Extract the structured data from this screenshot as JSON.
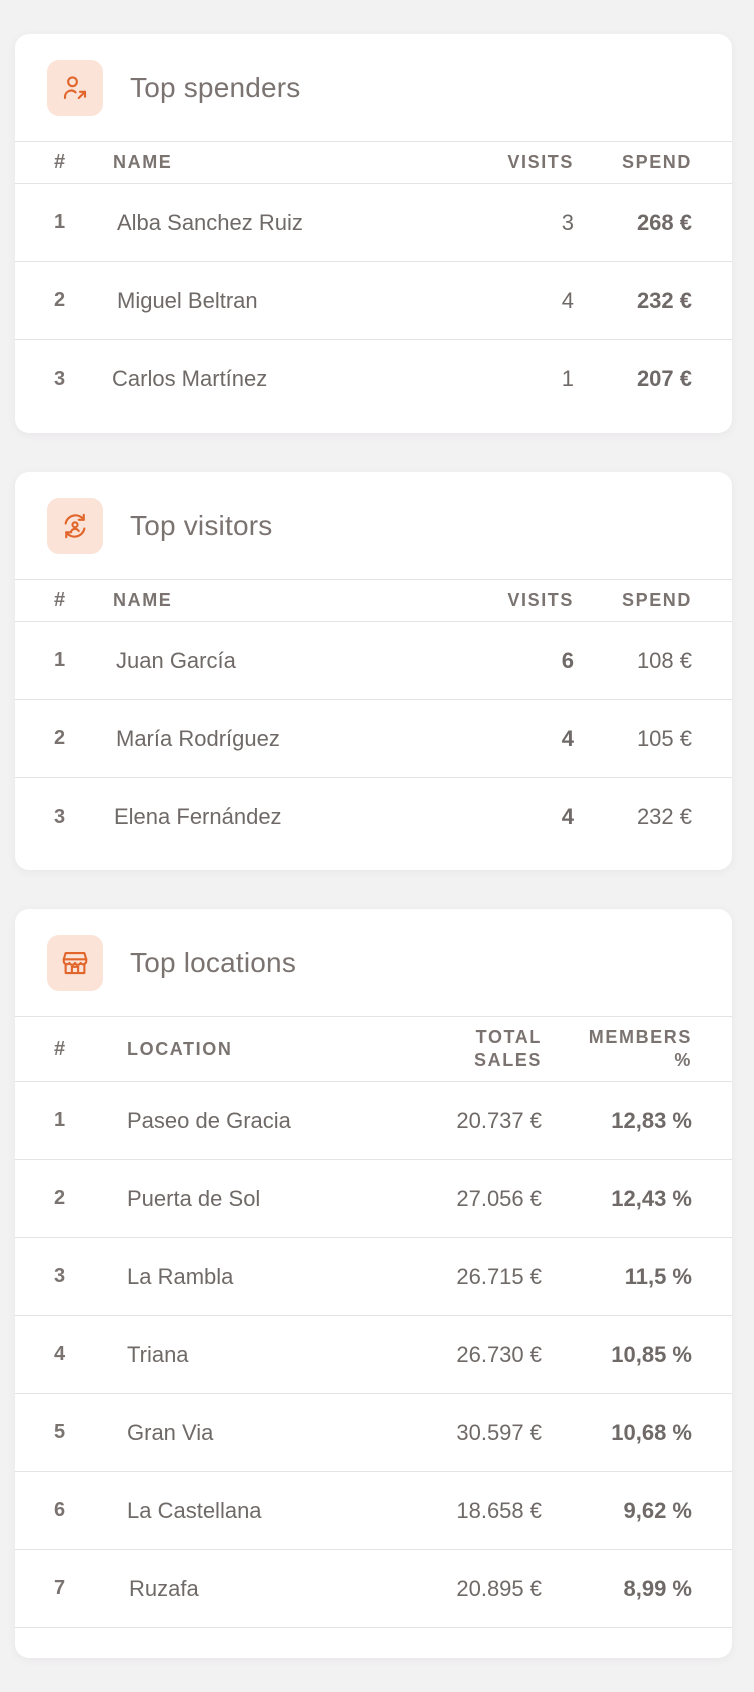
{
  "colors": {
    "accent": "#e0662b",
    "icon_bg": "#fbe3d8",
    "text": "#6f6a67"
  },
  "top_spenders": {
    "title": "Top spenders",
    "icon": "user-arrow-icon",
    "headers": {
      "idx": "#",
      "name": "NAME",
      "visits": "VISITS",
      "spend": "SPEND"
    },
    "rows": [
      {
        "idx": "1",
        "name": "Alba Sanchez Ruiz",
        "visits": "3",
        "spend": "268 €"
      },
      {
        "idx": "2",
        "name": "Miguel Beltran",
        "visits": "4",
        "spend": "232 €"
      },
      {
        "idx": "3",
        "name": "Carlos Martínez",
        "visits": "1",
        "spend": "207 €"
      }
    ]
  },
  "top_visitors": {
    "title": "Top visitors",
    "icon": "refresh-user-icon",
    "headers": {
      "idx": "#",
      "name": "NAME",
      "visits": "VISITS",
      "spend": "SPEND"
    },
    "rows": [
      {
        "idx": "1",
        "name": "Juan García",
        "visits": "6",
        "spend": "108 €"
      },
      {
        "idx": "2",
        "name": "María Rodríguez",
        "visits": "4",
        "spend": "105 €"
      },
      {
        "idx": "3",
        "name": "Elena Fernández",
        "visits": "4",
        "spend": "232 €"
      }
    ]
  },
  "top_locations": {
    "title": "Top locations",
    "icon": "store-icon",
    "headers": {
      "idx": "#",
      "location": "LOCATION",
      "total_sales_1": "TOTAL",
      "total_sales_2": "SALES",
      "members_1": "MEMBERS",
      "members_2": "%"
    },
    "rows": [
      {
        "idx": "1",
        "location": "Paseo de Gracia",
        "sales": "20.737 €",
        "members": "12,83 %"
      },
      {
        "idx": "2",
        "location": "Puerta de Sol",
        "sales": "27.056 €",
        "members": "12,43 %"
      },
      {
        "idx": "3",
        "location": "La Rambla",
        "sales": "26.715 €",
        "members": "11,5 %"
      },
      {
        "idx": "4",
        "location": "Triana",
        "sales": "26.730 €",
        "members": "10,85 %"
      },
      {
        "idx": "5",
        "location": "Gran Via",
        "sales": "30.597 €",
        "members": "10,68 %"
      },
      {
        "idx": "6",
        "location": "La Castellana",
        "sales": "18.658 €",
        "members": "9,62 %"
      },
      {
        "idx": "7",
        "location": "Ruzafa",
        "sales": "20.895 €",
        "members": "8,99 %"
      }
    ]
  }
}
